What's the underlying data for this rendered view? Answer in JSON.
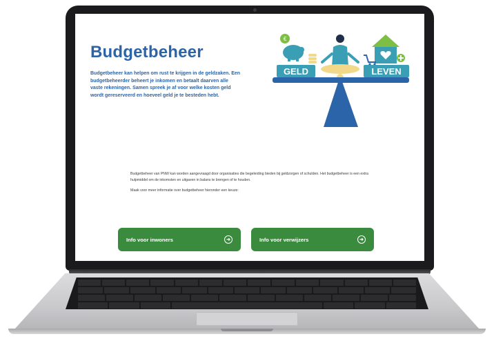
{
  "page": {
    "title": "Budgetbeheer",
    "intro": "Budgetbeheer kan helpen om rust te krijgen in de geldzaken. Een budgetbeheerder beheert je inkomen en betaalt daarven alle vaste rekeningen. Samen spreek je af voor welke kosten geld wordt gereserveerd en hoeveel geld je te besteden hebt.",
    "paragraph1": "Budgetbeheer van PNW kan worden aangevraagd door organisaties die begeleiding bieden bij geldzorgen of schulden. Het budgetbeheer is een extra hulpmiddel om de inkomsten en uitgaven in balans te brengen of te houden.",
    "paragraph2": "Maak voor meer informatie over budgetbeheer hieronder een keuze:"
  },
  "illustration": {
    "left_label": "GELD",
    "right_label": "LEVEN",
    "colors": {
      "teal": "#3a9fb5",
      "blue": "#2b64a8",
      "green": "#7dbf45",
      "sand": "#f2d98a"
    }
  },
  "buttons": [
    {
      "label": "Info voor inwoners",
      "icon": "arrow-right-circle-icon"
    },
    {
      "label": "Info voor verwijzers",
      "icon": "arrow-right-circle-icon"
    }
  ],
  "colors": {
    "button": "#3b8b3f",
    "heading": "#2b64a8"
  }
}
